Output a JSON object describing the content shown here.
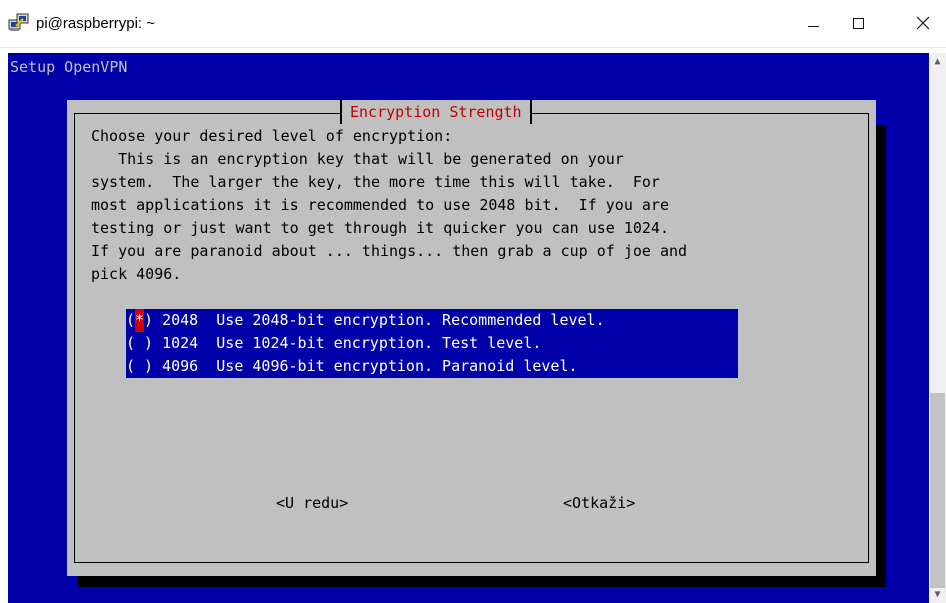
{
  "window": {
    "title": "pi@raspberrypi: ~",
    "minimize_icon": "minimize-icon",
    "maximize_icon": "maximize-icon",
    "close_icon": "close-icon"
  },
  "terminal": {
    "backtitle": "Setup OpenVPN",
    "background_color": "#0000a8"
  },
  "dialog": {
    "title": "Encryption Strength",
    "title_color": "#c00000",
    "prompt": "Choose your desired level of encryption:",
    "description_lines": [
      "   This is an encryption key that will be generated on your",
      "system.  The larger the key, the more time this will take.  For",
      "most applications it is recommended to use 2048 bit.  If you are",
      "testing or just want to get through it quicker you can use 1024.",
      "If you are paranoid about ... things... then grab a cup of joe and",
      "pick 4096."
    ],
    "options": [
      {
        "selected": true,
        "value": "2048",
        "description": "Use 2048-bit encryption. Recommended level."
      },
      {
        "selected": false,
        "value": "1024",
        "description": "Use 1024-bit encryption. Test level."
      },
      {
        "selected": false,
        "value": "4096",
        "description": "Use 4096-bit encryption. Paranoid level."
      }
    ],
    "ok_label": "<U redu>",
    "cancel_label": "<Otkaži>"
  }
}
